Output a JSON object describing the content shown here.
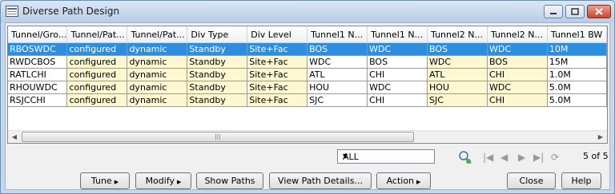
{
  "window": {
    "title": "Diverse Path Design"
  },
  "table": {
    "columns": [
      "Tunnel/Gro...",
      "Tunnel/Pat...",
      "Tunnel/Pat...",
      "Div Type",
      "Div Level",
      "Tunnel1 N...",
      "Tunnel1 N...",
      "Tunnel2 N...",
      "Tunnel2 N...",
      "Tunnel1 BW"
    ],
    "rows": [
      [
        "RBOSWDC",
        "configured",
        "dynamic",
        "Standby",
        "Site+Fac",
        "BOS",
        "WDC",
        "BOS",
        "WDC",
        "10M"
      ],
      [
        "RWDCBOS",
        "configured",
        "dynamic",
        "Standby",
        "Site+Fac",
        "WDC",
        "BOS",
        "WDC",
        "BOS",
        "15M"
      ],
      [
        "RATLCHI",
        "configured",
        "dynamic",
        "Standby",
        "Site+Fac",
        "ATL",
        "CHI",
        "ATL",
        "CHI",
        "1.0M"
      ],
      [
        "RHOUWDC",
        "configured",
        "dynamic",
        "Standby",
        "Site+Fac",
        "HOU",
        "WDC",
        "HOU",
        "WDC",
        "5.0M"
      ],
      [
        "RSJCCHI",
        "configured",
        "dynamic",
        "Standby",
        "Site+Fac",
        "SJC",
        "CHI",
        "SJC",
        "CHI",
        "5.0M"
      ]
    ],
    "selected_row": 0
  },
  "filter": {
    "value": "ALL"
  },
  "pager": {
    "count": "5 of 5"
  },
  "buttons": {
    "tune": "Tune",
    "modify": "Modify",
    "show_paths": "Show Paths",
    "view_path_details": "View Path Details...",
    "action": "Action",
    "close": "Close",
    "help": "Help"
  },
  "icons": [
    "app-icon",
    "minimize-icon",
    "maximize-icon",
    "close-icon",
    "dropdown-icon",
    "search-icon",
    "first-page-icon",
    "prev-page-icon",
    "next-page-icon",
    "last-page-icon",
    "refresh-icon"
  ],
  "colors": {
    "selection": "#2f8de0",
    "editable_cell": "#fdf7d2"
  }
}
